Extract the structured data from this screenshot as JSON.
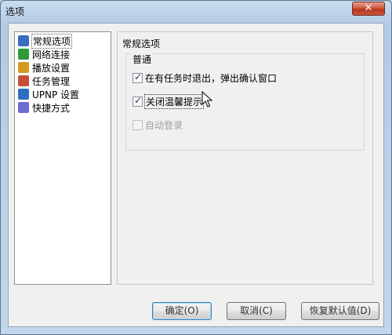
{
  "window": {
    "title": "选项",
    "close_label": "✕"
  },
  "tree": {
    "items": [
      {
        "label": "常规选项",
        "icon": "general-settings-icon",
        "color": "#3a6cc0"
      },
      {
        "label": "网络连接",
        "icon": "network-icon",
        "color": "#2f9a3a"
      },
      {
        "label": "播放设置",
        "icon": "playback-icon",
        "color": "#d49a1e"
      },
      {
        "label": "任务管理",
        "icon": "task-icon",
        "color": "#c84e3a"
      },
      {
        "label": "UPNP 设置",
        "icon": "upnp-icon",
        "color": "#2f6fbf"
      },
      {
        "label": "快捷方式",
        "icon": "shortcut-icon",
        "color": "#6b6bd1"
      }
    ]
  },
  "panel": {
    "title": "常规选项",
    "group_title": "普通",
    "options": [
      {
        "label": "在有任务时退出，弹出确认窗口",
        "checked": true,
        "enabled": true
      },
      {
        "label": "关闭温馨提示",
        "checked": true,
        "enabled": true
      },
      {
        "label": "自动登录",
        "checked": false,
        "enabled": false
      }
    ]
  },
  "buttons": {
    "ok": "确定(O)",
    "cancel": "取消(C)",
    "restore": "恢复默认值(D)"
  }
}
